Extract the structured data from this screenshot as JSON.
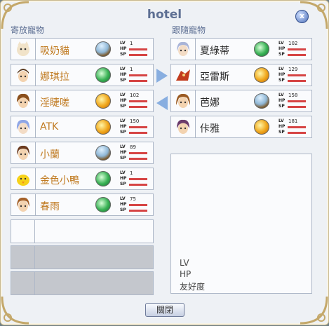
{
  "window": {
    "title": "hotel",
    "close_label": "x"
  },
  "sections": {
    "left_label": "寄放寵物",
    "right_label": "跟隨寵物"
  },
  "left_pets": [
    {
      "name": "吸奶貓",
      "level": "1",
      "element": "earth"
    },
    {
      "name": "娜琪拉",
      "level": "1",
      "element": "wind"
    },
    {
      "name": "淫睫嗟",
      "level": "102",
      "element": "sun"
    },
    {
      "name": "ATK",
      "level": "150",
      "element": "sun"
    },
    {
      "name": "小蘭",
      "level": "89",
      "element": "earth"
    },
    {
      "name": "金色小鴨",
      "level": "1",
      "element": "wind"
    },
    {
      "name": "春雨",
      "level": "75",
      "element": "wind"
    }
  ],
  "right_pets": [
    {
      "name": "夏綠蒂",
      "level": "102",
      "element": "wind"
    },
    {
      "name": "亞雷斯",
      "level": "129",
      "element": "sun"
    },
    {
      "name": "芭娜",
      "level": "158",
      "element": "earth"
    },
    {
      "name": "佧雅",
      "level": "181",
      "element": "sun"
    }
  ],
  "stat_labels": {
    "lv": "LV",
    "hp": "HP",
    "sp": "SP"
  },
  "info": {
    "lv_label": "LV",
    "hp_label": "HP",
    "affinity_label": "友好度"
  },
  "buttons": {
    "close_label": "關閉"
  },
  "colors": {
    "accent": "#5d6f93",
    "name_left": "#c07a20",
    "bar": "#d64545",
    "arrow": "#88aee0"
  }
}
